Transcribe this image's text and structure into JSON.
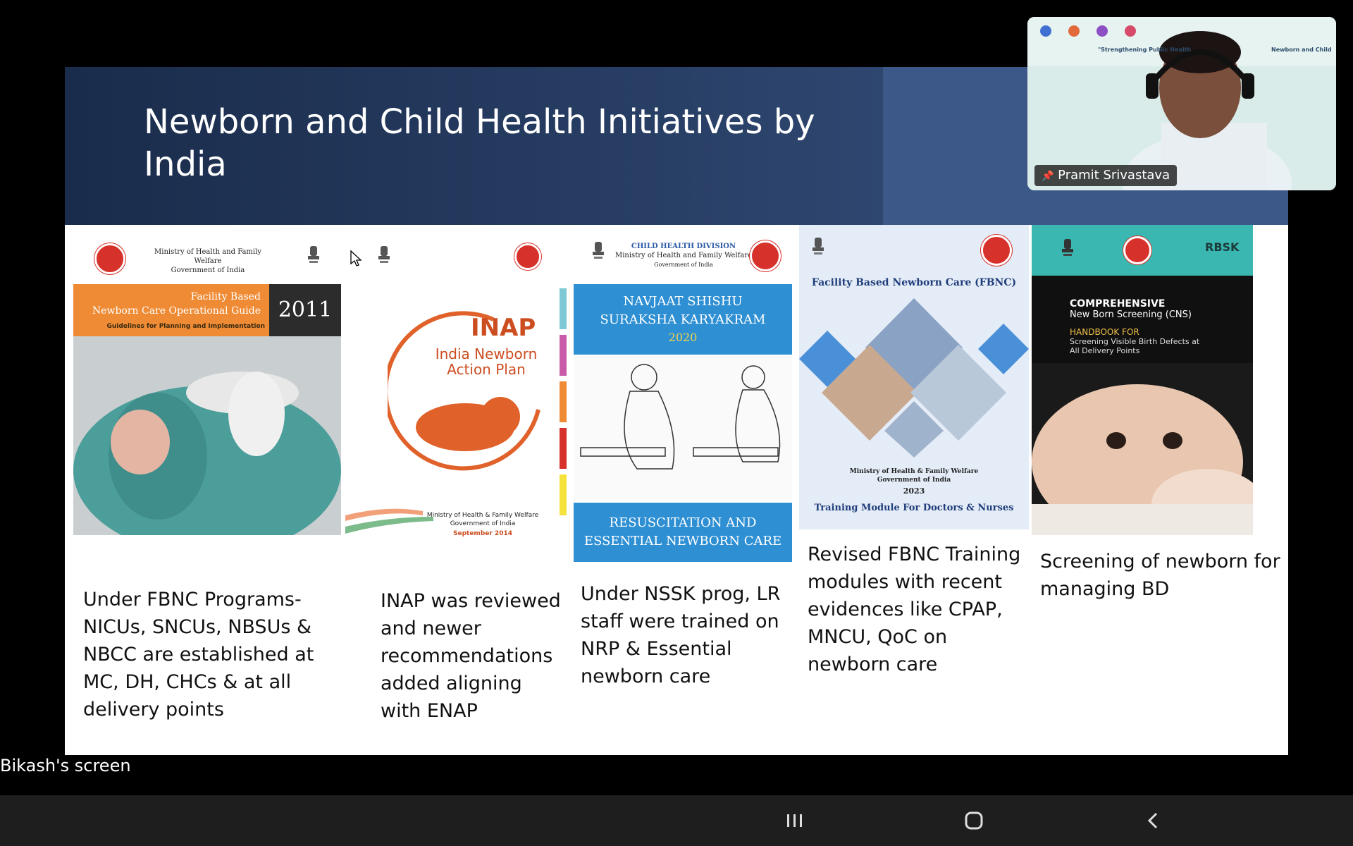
{
  "slide": {
    "title": "Newborn and Child Health Initiatives by India"
  },
  "cards": [
    {
      "caption": "Under FBNC Programs- NICUs, SNCUs, NBSUs & NBCC are established at MC, DH, CHCs & at all delivery points",
      "cover": {
        "ministry": "Ministry of Health and Family Welfare",
        "government": "Government of India",
        "title_line1": "Facility Based",
        "title_line2": "Newborn Care Operational Guide",
        "subtitle": "Guidelines for Planning and Implementation",
        "year": "2011"
      }
    },
    {
      "caption": "INAP was reviewed and newer recommendations added aligning with ENAP",
      "cover": {
        "acronym": "INAP",
        "name_line1": "India Newborn",
        "name_line2": "Action Plan",
        "ministry": "Ministry of Health & Family Welfare",
        "government": "Government of India",
        "date": "September 2014"
      }
    },
    {
      "caption": "Under NSSK prog, LR staff were trained on NRP & Essential newborn care",
      "cover": {
        "division": "CHILD HEALTH DIVISION",
        "ministry": "Ministry of Health and Family Welfare",
        "government": "Government of India",
        "title_line1": "NAVJAAT SHISHU",
        "title_line2": "SURAKSHA KARYAKRAM",
        "year": "2020",
        "bottom_line1": "RESUSCITATION AND",
        "bottom_line2": "ESSENTIAL NEWBORN CARE"
      }
    },
    {
      "caption": "Revised FBNC Training modules with recent evidences like CPAP, MNCU, QoC on newborn care",
      "cover": {
        "title": "Facility Based Newborn Care (FBNC)",
        "ministry": "Ministry of Health & Family Welfare",
        "government": "Government of India",
        "year": "2023",
        "module": "Training Module For Doctors & Nurses"
      }
    },
    {
      "caption": "Screening of newborn for managing BD",
      "cover": {
        "brand": "RBSK",
        "title_line1": "COMPREHENSIVE",
        "title_line2": "New Born Screening (CNS)",
        "handbook": "HANDBOOK FOR",
        "sub_line1": "Screening Visible Birth Defects at",
        "sub_line2": "All Delivery Points"
      }
    }
  ],
  "video": {
    "participant_name": "Pramit Srivastava",
    "banner_text": "\"Strengthening Public Health",
    "banner_right": "Newborn and Child"
  },
  "share": {
    "label": "Bikash's screen"
  },
  "colors": {
    "header_dark": "#1a2c4b",
    "header_light": "#3c5888",
    "orange": "#ef8b35",
    "blue": "#2e8fd3",
    "teal": "#3ab7b0",
    "red": "#d6322b"
  },
  "icons": {
    "pin": "pin-icon",
    "recents": "recent-apps-icon",
    "home": "home-icon",
    "back": "back-icon"
  }
}
